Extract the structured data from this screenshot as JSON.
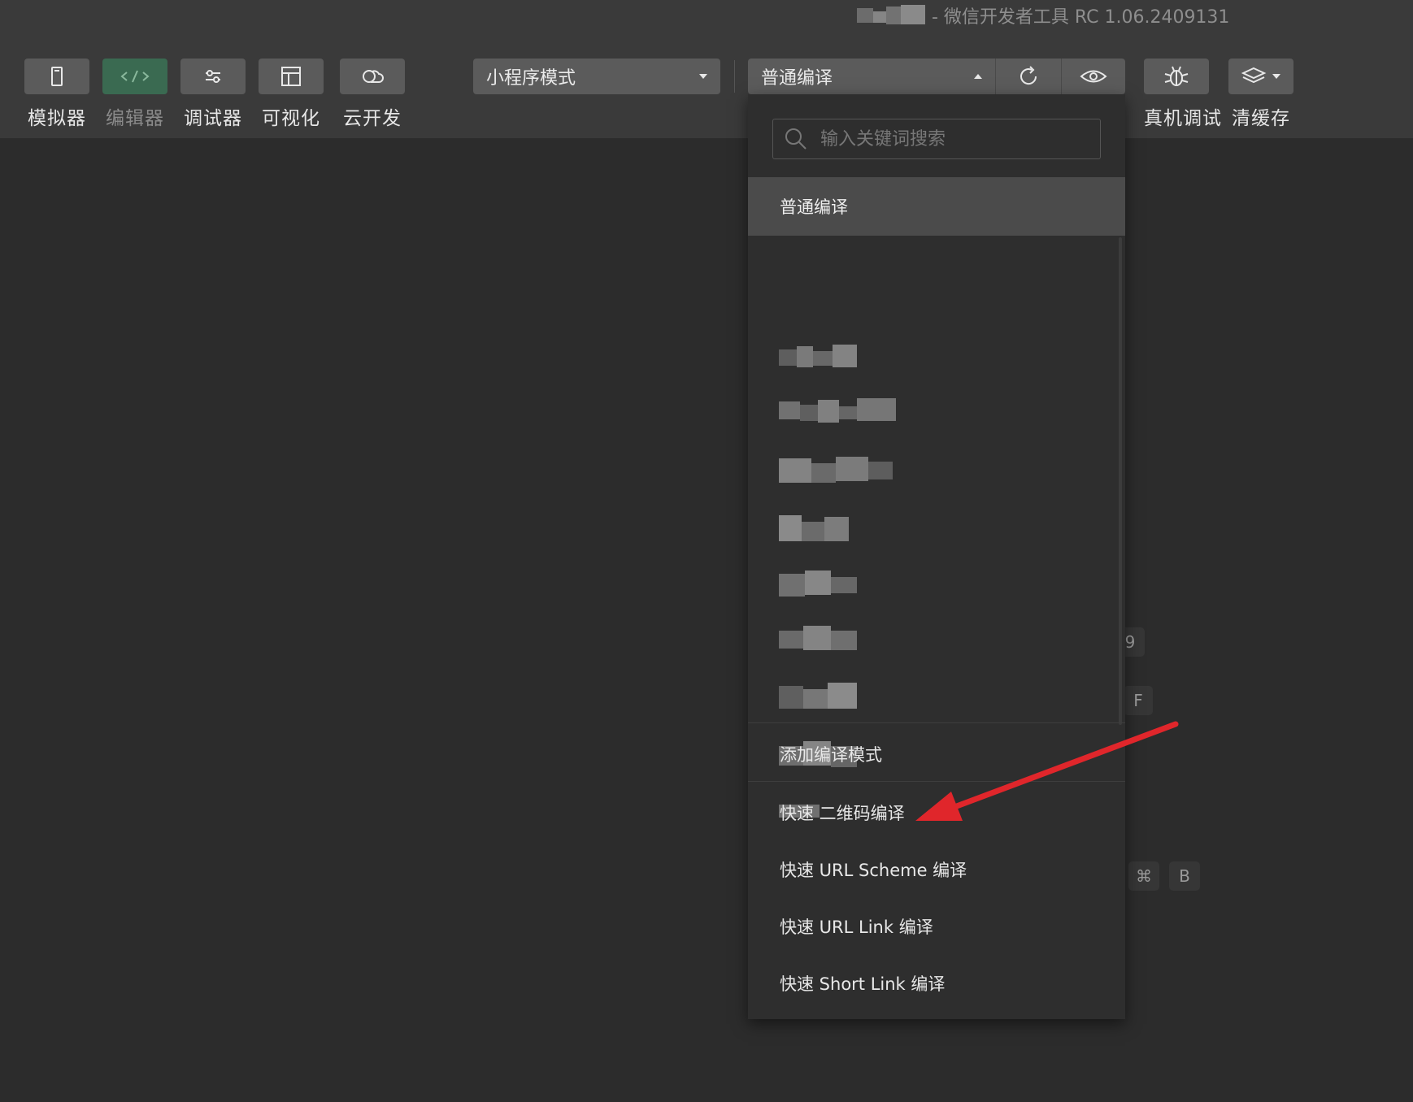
{
  "window": {
    "title": "- 微信开发者工具 RC 1.06.2409131"
  },
  "toolbar": {
    "tools": [
      {
        "label": "模拟器",
        "icon": "phone-icon"
      },
      {
        "label": "编辑器",
        "icon": "code-icon"
      },
      {
        "label": "调试器",
        "icon": "debug-sliders-icon"
      },
      {
        "label": "可视化",
        "icon": "layout-icon"
      },
      {
        "label": "云开发",
        "icon": "cloud-icon"
      }
    ],
    "mode_select": "小程序模式",
    "compile_select": "普通编译",
    "right_tools": [
      {
        "label": "真机调试",
        "icon": "bug-icon"
      },
      {
        "label": "清缓存",
        "icon": "layers-icon"
      }
    ]
  },
  "dropdown": {
    "search_placeholder": "输入关键词搜索",
    "selected_item": "普通编译",
    "add_mode": "添加编译模式",
    "quick_items": [
      "快速 二维码编译",
      "快速 URL Scheme 编译",
      "快速 URL Link 编译",
      "快速 Short Link 编译"
    ]
  },
  "side_keys": {
    "k1": "9",
    "k2": "F",
    "k3": "⌘",
    "k4": "B"
  },
  "colors": {
    "background": "#2c2c2c",
    "toolbar": "#3a3a3a",
    "button": "#5b5b5b",
    "active_editor": "#3a6a51",
    "arrow": "#e0262b"
  }
}
